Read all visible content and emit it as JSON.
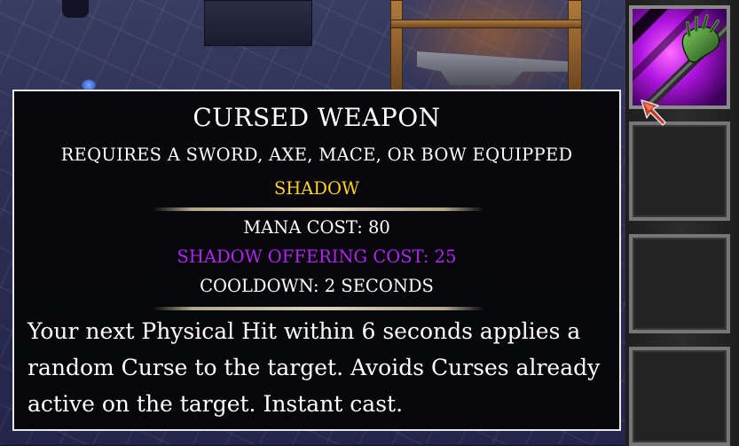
{
  "tooltip": {
    "title": "CURSED WEAPON",
    "requirement": "REQUIRES A SWORD, AXE, MACE, OR BOW EQUIPPED",
    "school": "SHADOW",
    "mana_cost": "MANA COST: 80",
    "offering_cost": "SHADOW OFFERING COST: 25",
    "cooldown": "COOLDOWN: 2 SECONDS",
    "description": "Your next Physical Hit within 6 seconds applies a random Curse to the target. Avoids Curses already active on the target. Instant cast.",
    "colors": {
      "school": "#ffd21c",
      "offering": "#b224f0",
      "text": "#ffffff",
      "border": "#e9e9e9"
    }
  },
  "skill_bar": {
    "slots": [
      {
        "icon": "cursed-weapon-skill-icon",
        "filled": true
      },
      {
        "icon": "",
        "filled": false
      },
      {
        "icon": "",
        "filled": false
      },
      {
        "icon": "",
        "filled": false
      }
    ]
  },
  "cursor": {
    "icon": "sword-cursor-icon"
  }
}
